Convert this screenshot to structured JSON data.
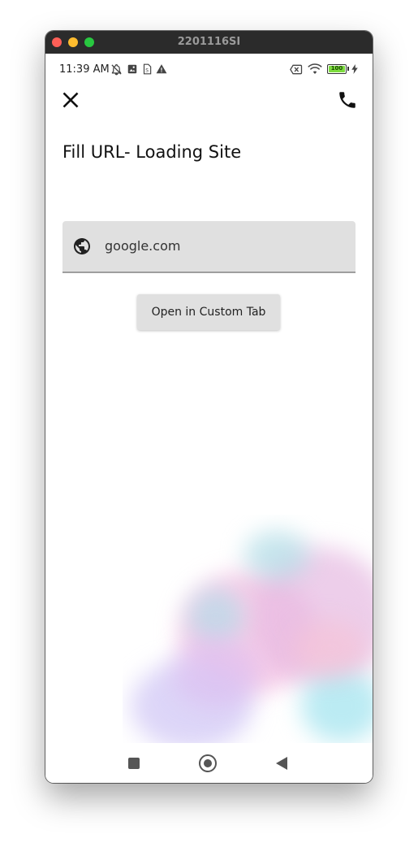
{
  "window": {
    "title": "2201116SI"
  },
  "status_bar": {
    "time": "11:39 AM",
    "battery_level": "100",
    "battery_fraction": 1.0,
    "left_icons": [
      "notifications-off-icon",
      "image-icon",
      "sim-icon",
      "warning-icon"
    ],
    "right_icons": [
      "no-sim-icon",
      "wifi-icon",
      "battery-icon",
      "charging-icon"
    ]
  },
  "app_bar": {
    "close_icon": "close-icon",
    "call_icon": "phone-icon"
  },
  "page": {
    "title": "Fill URL- Loading Site"
  },
  "url_field": {
    "icon": "globe-icon",
    "value": "google.com"
  },
  "actions": {
    "open_custom_tab_label": "Open in Custom Tab"
  },
  "nav_bar": {
    "recents_icon": "square-icon",
    "home_icon": "home-circle-icon",
    "back_icon": "back-triangle-icon"
  },
  "colors": {
    "field_background": "#e0e0e0",
    "titlebar": "#2b2b2b",
    "battery_fill": "#7ddc3e"
  }
}
